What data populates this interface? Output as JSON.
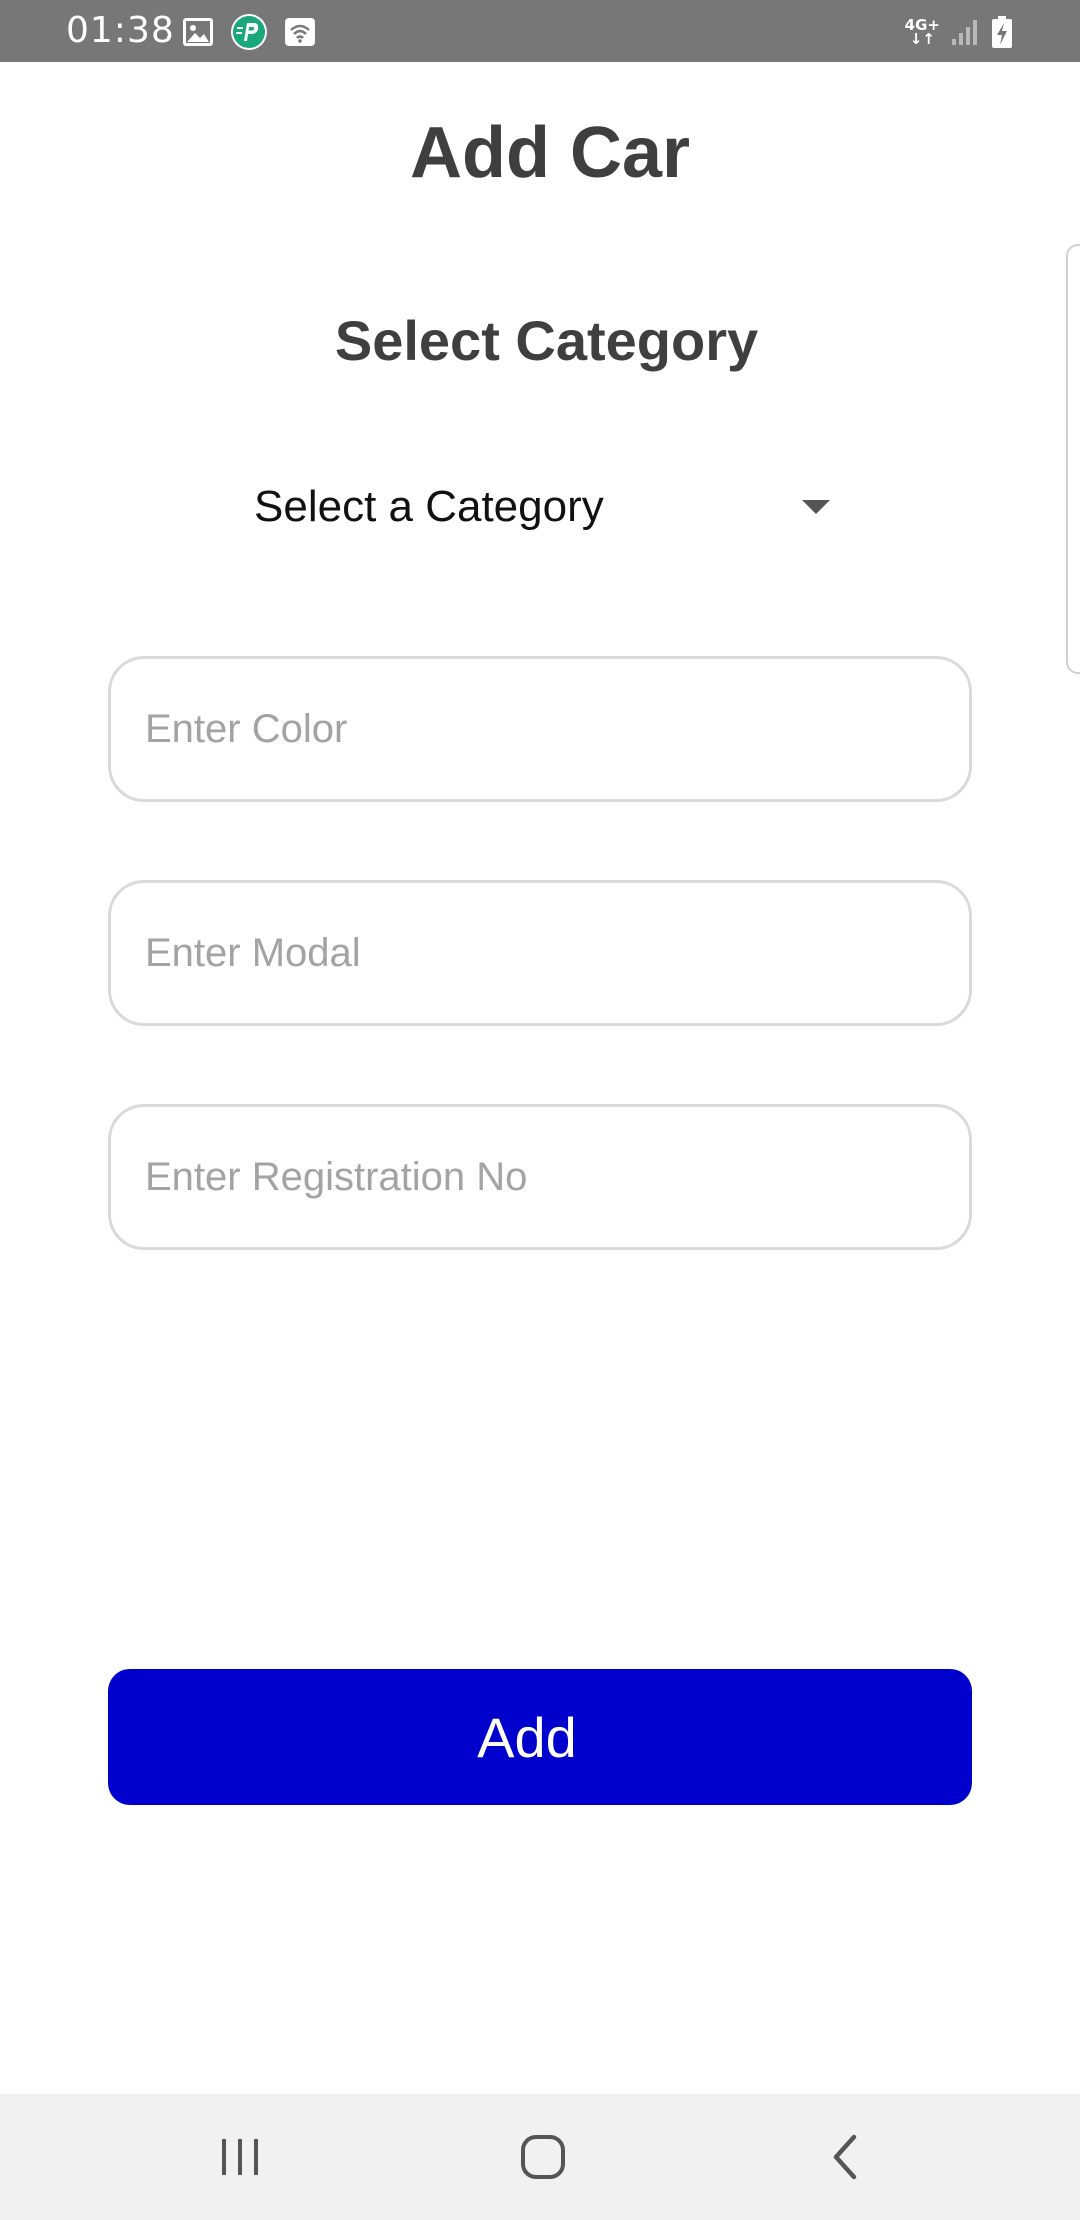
{
  "status_bar": {
    "time": "01:38",
    "network": "4G+",
    "left_icons": [
      "gallery-icon",
      "parking-app-icon",
      "wifi-calling-icon"
    ],
    "right_icons": [
      "signal-icon",
      "battery-charging-icon"
    ]
  },
  "header": {
    "title": "Add Car"
  },
  "category": {
    "section_title": "Select Category",
    "selected_value": "Select a Category"
  },
  "form": {
    "color_placeholder": "Enter Color",
    "modal_placeholder": "Enter Modal",
    "registration_placeholder": "Enter Registration No",
    "color_value": "",
    "modal_value": "",
    "registration_value": ""
  },
  "actions": {
    "add_label": "Add"
  },
  "colors": {
    "status_bar": "#777777",
    "primary_button": "#0000cc",
    "title_text": "#3f3f3f",
    "placeholder_text": "#a3a3a3",
    "input_border": "#dadada",
    "nav_bar": "#f1f1f1",
    "app_badge": "#1aa779"
  },
  "navigation": {
    "buttons": [
      "recent-apps-icon",
      "home-icon",
      "back-icon"
    ]
  }
}
